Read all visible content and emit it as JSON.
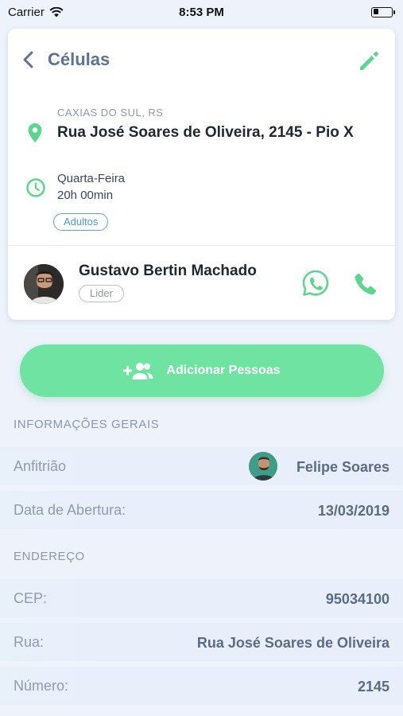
{
  "status_bar": {
    "carrier": "Carrier",
    "time": "8:53 PM",
    "battery_level": 0.3
  },
  "header": {
    "title": "Células",
    "back_icon": "chevron-left-icon",
    "edit_icon": "pencil-icon"
  },
  "cell": {
    "city": "CAXIAS DO SUL, RS",
    "street": "Rua José Soares de Oliveira, 2145 - Pio X",
    "weekday": "Quarta-Feira",
    "hour": "20h 00min",
    "tag": "Adultos"
  },
  "leader": {
    "name": "Gustavo Bertin Machado",
    "role": "Lider"
  },
  "add_button": {
    "label": "Adicionar Pessoas",
    "icon": "add-people-icon"
  },
  "general_info": {
    "title": "INFORMAÇÕES GERAIS",
    "host_label": "Anfitrião",
    "host_value": "Felipe Soares",
    "opening_label": "Data de Abertura:",
    "opening_value": "13/03/2019"
  },
  "address": {
    "title": "ENDEREÇO",
    "cep_label": "CEP:",
    "cep_value": "95034100",
    "street_label": "Rua:",
    "street_value": "Rua José Soares de Oliveira",
    "number_label": "Número:",
    "number_value": "2145"
  },
  "colors": {
    "accent_green": "#6fe3a2",
    "icon_green": "#5cd68f",
    "title_blue": "#5c7194",
    "badge_blue": "#4a9bd0"
  }
}
